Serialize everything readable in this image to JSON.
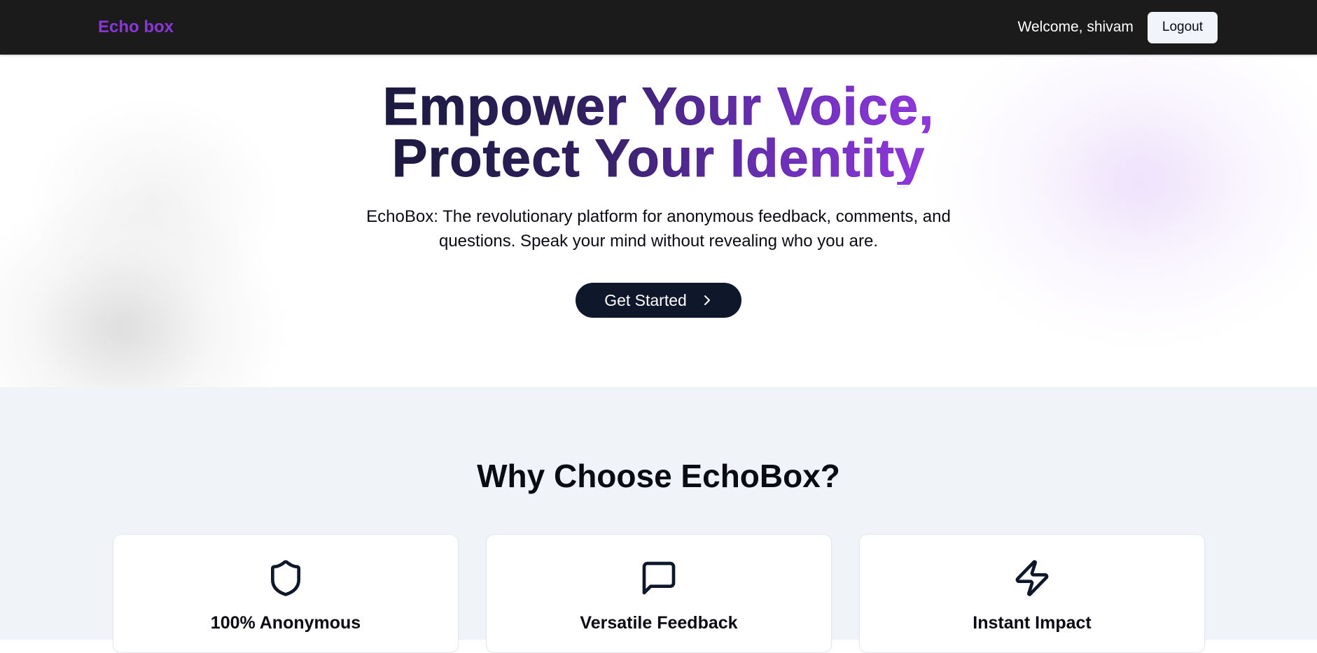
{
  "navbar": {
    "brand": "Echo box",
    "welcome": "Welcome, shivam",
    "logout_label": "Logout"
  },
  "hero": {
    "headline_line1": "Empower Your Voice,",
    "headline_line2": "Protect Your Identity",
    "subtitle": "EchoBox: The revolutionary platform for anonymous feedback, comments, and questions. Speak your mind without revealing who you are.",
    "cta_label": "Get Started",
    "cta_icon": "chevron-right-icon"
  },
  "features": {
    "title": "Why Choose EchoBox?",
    "cards": [
      {
        "icon": "shield-icon",
        "title": "100% Anonymous"
      },
      {
        "icon": "message-square-icon",
        "title": "Versatile Feedback"
      },
      {
        "icon": "zap-icon",
        "title": "Instant Impact"
      }
    ]
  },
  "colors": {
    "brand": "#8b36db",
    "navbar_bg": "#1b1b1b",
    "cta_bg": "#0f172a",
    "features_bg": "#f0f3f8",
    "headline_gradient_start": "#1c1a40",
    "headline_gradient_end": "#9238e0"
  }
}
